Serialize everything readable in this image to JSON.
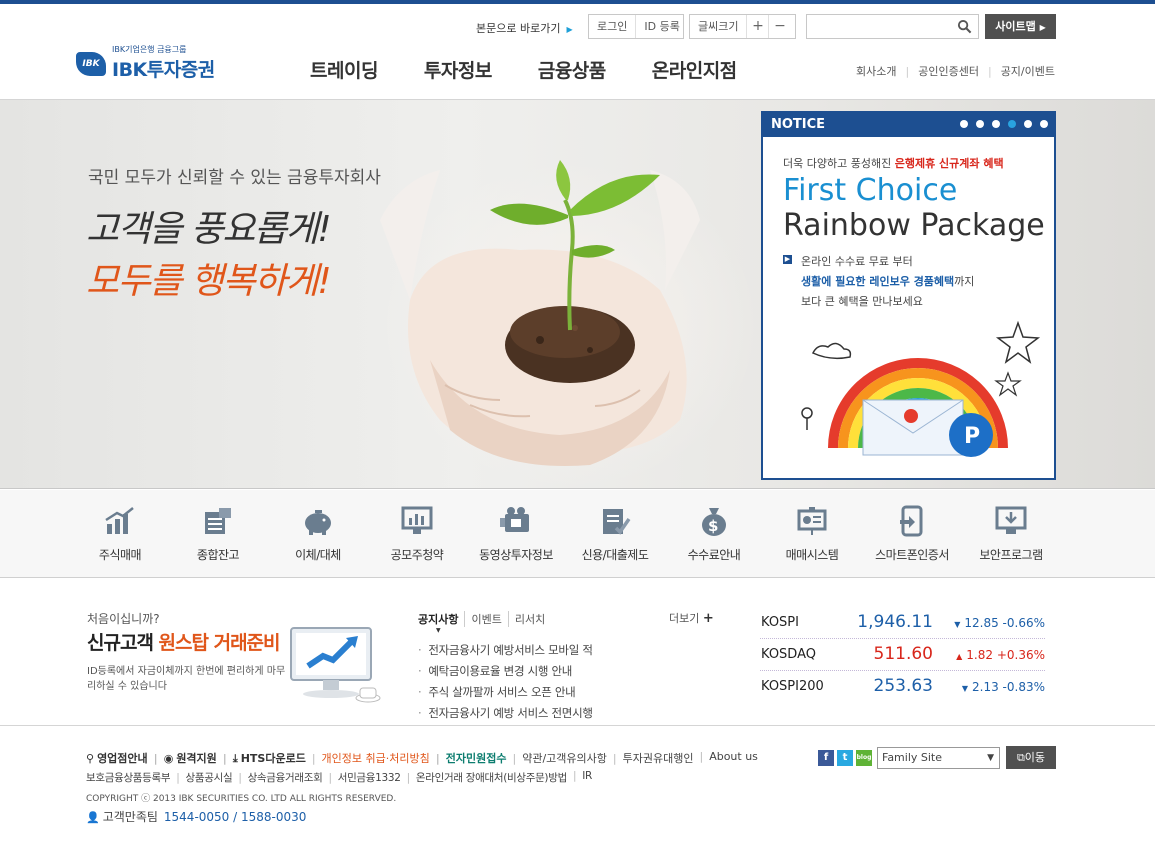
{
  "colors": {
    "brand": "#1d4f91",
    "accent": "#e0561a",
    "down": "#1d5fa8",
    "up": "#d8261b"
  },
  "header": {
    "logo": {
      "group": "IBK기업은행 금융그룹",
      "name": "IBK투자증권",
      "mark": "IBK"
    },
    "skip_link": "본문으로 바로가기",
    "login": "로그인",
    "id_register": "ID 등록",
    "font_size": "글씨크기",
    "font_plus": "+",
    "font_minus": "−",
    "search": {
      "placeholder": "",
      "icon": "search-icon"
    },
    "sitemap": "사이트맵",
    "gnb": [
      "트레이딩",
      "투자정보",
      "금융상품",
      "온라인지점"
    ],
    "sub_links": [
      "회사소개",
      "공인인증센터",
      "공지/이벤트"
    ]
  },
  "hero": {
    "tagline": "국민 모두가 신뢰할 수 있는 금융투자회사",
    "line1": "고객을 풍요롭게!",
    "line2": "모두를 행복하게!"
  },
  "notice": {
    "title": "NOTICE",
    "lead_plain": "더욱 다양하고 풍성해진 ",
    "lead_highlight": "은행제휴 신규계좌 혜택",
    "headline1": "First Choice",
    "headline2": "Rainbow Package",
    "body1": "온라인 수수료 무료 부터",
    "body2_highlight": "생활에 필요한 레인보우 경품혜택",
    "body2_plain": "까지",
    "body3": "보다 큰 혜택을 만나보세요",
    "badge": "P",
    "slides_total": 6,
    "slide_active": 4
  },
  "quick_menu": [
    {
      "label": "주식매매",
      "icon": "stock-chart-icon"
    },
    {
      "label": "종합잔고",
      "icon": "balance-sheet-icon"
    },
    {
      "label": "이체/대체",
      "icon": "piggy-bank-icon"
    },
    {
      "label": "공모주청약",
      "icon": "monitor-chart-icon"
    },
    {
      "label": "동영상투자정보",
      "icon": "video-camera-icon"
    },
    {
      "label": "신용/대출제도",
      "icon": "document-check-icon"
    },
    {
      "label": "수수료안내",
      "icon": "money-bag-icon"
    },
    {
      "label": "매매시스템",
      "icon": "presentation-board-icon"
    },
    {
      "label": "스마트폰인증서",
      "icon": "smartphone-icon"
    },
    {
      "label": "보안프로그램",
      "icon": "download-monitor-icon"
    }
  ],
  "promo": {
    "small": "처음이십니까?",
    "big_plain": "신규고객 ",
    "big_highlight": "원스탑 거래준비",
    "desc": "ID등록에서 자금이체까지 한번에 편리하게 마무리하실 수 있습니다"
  },
  "board": {
    "tabs": [
      "공지사항",
      "이벤트",
      "리서치"
    ],
    "more": "더보기",
    "items": [
      "전자금융사기 예방서비스 모바일 적",
      "예탁금이용료율 변경 시행 안내",
      "주식 살까팔까 서비스 오픈 안내",
      "전자금융사기 예방 서비스 전면시행"
    ]
  },
  "indices": [
    {
      "name": "KOSPI",
      "value": "1,946.11",
      "change": "12.85",
      "pct": "-0.66%",
      "dir": "down",
      "arrow": "▼"
    },
    {
      "name": "KOSDAQ",
      "value": "511.60",
      "change": "1.82",
      "pct": "+0.36%",
      "dir": "up",
      "arrow": "▲"
    },
    {
      "name": "KOSPI200",
      "value": "253.63",
      "change": "2.13",
      "pct": "-0.83%",
      "dir": "down",
      "arrow": "▼"
    }
  ],
  "footer": {
    "row1": [
      {
        "label": "영업점안내",
        "style": "bold",
        "icon": "location-pin-icon"
      },
      {
        "label": "원격지원",
        "style": "bold",
        "icon": "remote-support-icon"
      },
      {
        "label": "HTS다운로드",
        "style": "bold",
        "icon": "download-icon"
      },
      {
        "label": "개인정보 취급·처리방침",
        "style": "orange"
      },
      {
        "label": "전자민원접수",
        "style": "green"
      },
      {
        "label": "약관/고객유의사항",
        "style": ""
      },
      {
        "label": "투자권유대행인",
        "style": ""
      },
      {
        "label": "About us",
        "style": ""
      }
    ],
    "row2": [
      "보호금융상품등록부",
      "상품공시실",
      "상속금융거래조회",
      "서민금융1332",
      "온라인거래 장애대처(비상주문)방법",
      "IR"
    ],
    "copyright": "COPYRIGHT ⓒ 2013 IBK SECURITIES CO. LTD ALL RIGHTS RESERVED.",
    "call_label": "고객만족팀",
    "call_numbers": "1544-0050 / 1588-0030",
    "family_site": "Family Site",
    "move": "이동",
    "social": [
      {
        "name": "facebook-icon",
        "glyph": "f",
        "color": "#3b5998"
      },
      {
        "name": "twitter-icon",
        "glyph": "t",
        "color": "#29a9e1"
      },
      {
        "name": "blog-icon",
        "glyph": "blog",
        "color": "#5fb336"
      }
    ]
  }
}
